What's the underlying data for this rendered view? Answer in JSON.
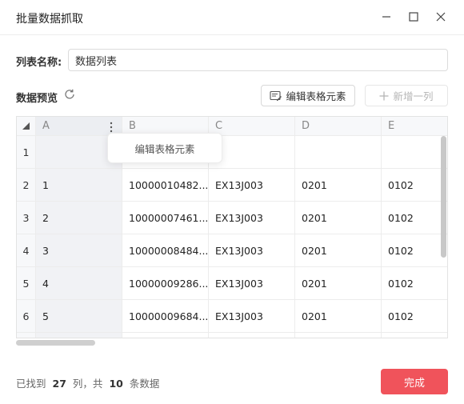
{
  "window": {
    "title": "批量数据抓取"
  },
  "form": {
    "list_name_label": "列表名称:",
    "list_name_value": "数据列表"
  },
  "preview": {
    "label": "数据预览",
    "edit_button": "编辑表格元素",
    "add_column_button": "新增一列"
  },
  "table": {
    "columns": [
      "A",
      "B",
      "C",
      "D",
      "E"
    ],
    "rows": [
      {
        "index": "1",
        "cells": [
          "",
          "",
          "",
          "",
          ""
        ]
      },
      {
        "index": "2",
        "cells": [
          "1",
          "10000010482...",
          "EX13J003",
          "0201",
          "0102"
        ]
      },
      {
        "index": "3",
        "cells": [
          "2",
          "10000007461...",
          "EX13J003",
          "0201",
          "0102"
        ]
      },
      {
        "index": "4",
        "cells": [
          "3",
          "10000008484...",
          "EX13J003",
          "0201",
          "0102"
        ]
      },
      {
        "index": "5",
        "cells": [
          "4",
          "10000009286...",
          "EX13J003",
          "0201",
          "0102"
        ]
      },
      {
        "index": "6",
        "cells": [
          "5",
          "10000009684...",
          "EX13J003",
          "0201",
          "0102"
        ]
      },
      {
        "index": "",
        "cells": [
          "",
          "",
          "",
          "",
          ""
        ]
      }
    ],
    "context_menu_item": "编辑表格元素"
  },
  "footer": {
    "found_prefix": "已找到",
    "columns_count": "27",
    "columns_suffix": "列，共",
    "rows_count": "10",
    "rows_suffix": "条数据",
    "done_button": "完成"
  },
  "colors": {
    "accent": "#f0535b",
    "selected_column": "#f1f2f5",
    "border": "#e3e3e3"
  }
}
